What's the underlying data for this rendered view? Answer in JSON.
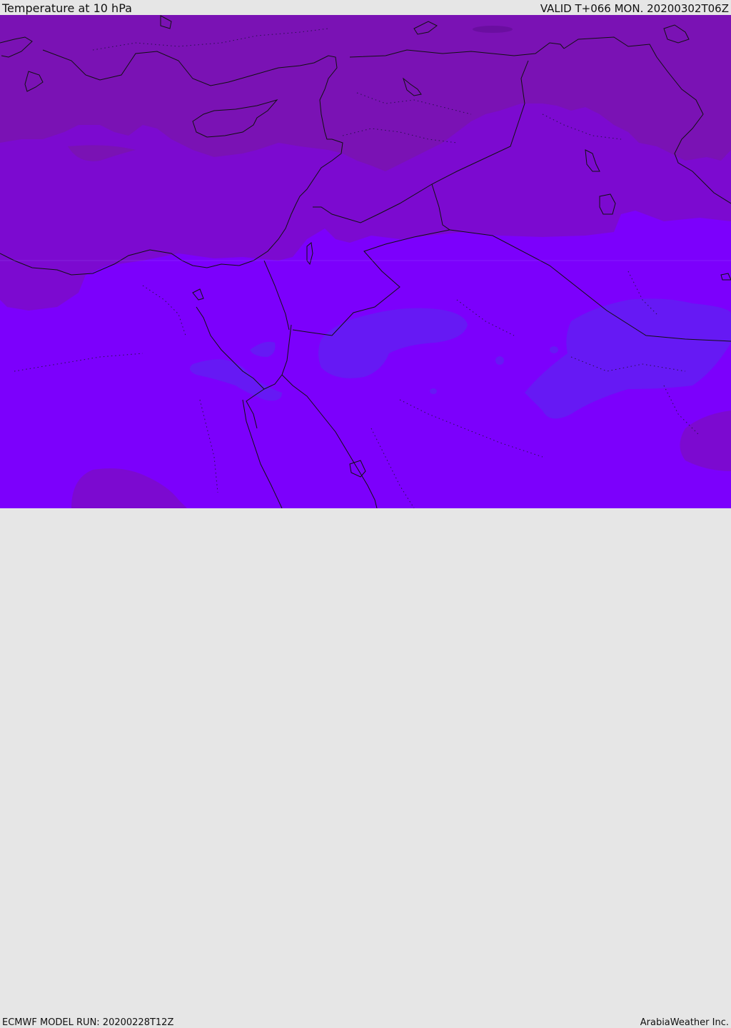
{
  "header": {
    "title": "Temperature at 10 hPa",
    "valid": "VALID T+066 MON. 20200302T06Z"
  },
  "footer": {
    "model_run": "ECMWF MODEL RUN: 20200228T12Z",
    "brand": "ArabiaWeather Inc."
  },
  "colors": {
    "coldest_band": "#7a12b4",
    "mid_band": "#7c0ad0",
    "warm_band": "#7c00fc",
    "warmest_band": "#6619f4",
    "coastline": "#111111",
    "header_bg": "#e6e6e6"
  }
}
